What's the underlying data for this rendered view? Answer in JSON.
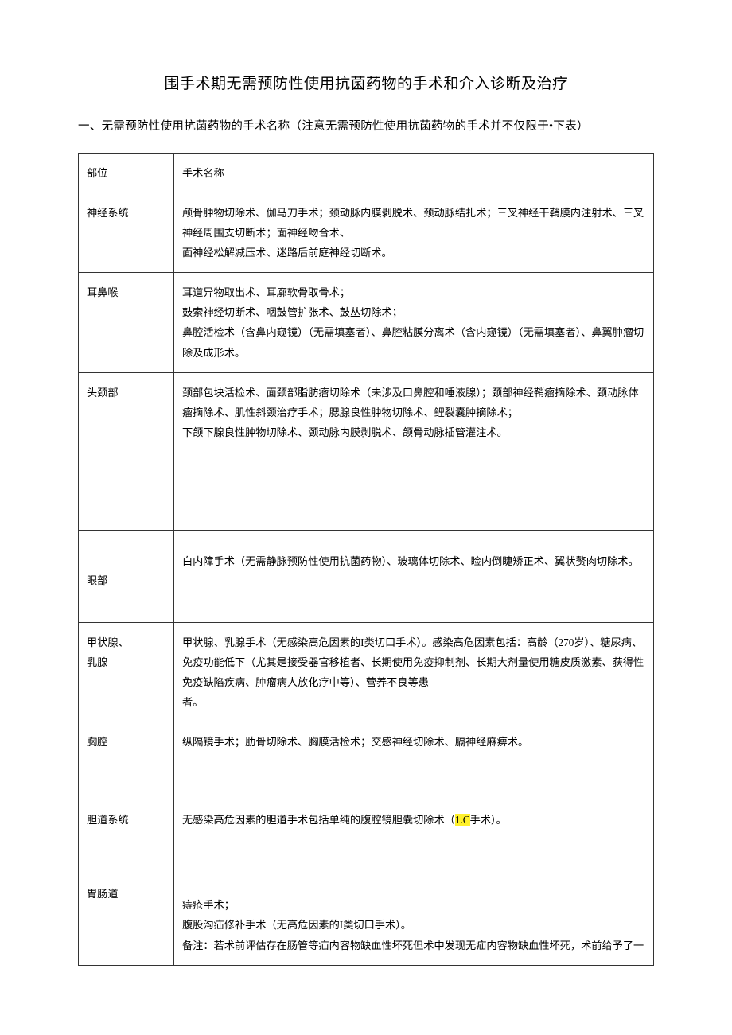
{
  "title": "围手术期无需预防性使用抗菌药物的手术和介入诊断及治疗",
  "subtitle": "一、无需预防性使用抗菌药物的手术名称（注意无需预防性使用抗菌药物的手术并不仅限于•下表）",
  "header": {
    "site": "部位",
    "name": "手术名称"
  },
  "rows": [
    {
      "site": "神经系统",
      "l1": "颅骨肿物切除术、伽马刀手术；颈动脉内膜剥脱术、颈动脉结扎术；三叉神经干鞘膜内注射术、三叉神经周围支切断术；面神经吻合术、",
      "l2": "面神经松解减压术、迷路后前庭神经切断术。"
    },
    {
      "site": "耳鼻喉",
      "l1": "耳道异物取出术、耳廓软骨取骨术；",
      "l2": "鼓索神经切断术、咽鼓管扩张术、鼓丛切除术；",
      "l3": "鼻腔活检术（含鼻内窥镜）（无需填塞者）、鼻腔粘膜分离术（含内窥镜）（无需填塞者）、鼻翼肿瘤切除及成形术。"
    },
    {
      "site": "头颈部",
      "l1": "颈部包块活检术、面颈部脂肪瘤切除术（未涉及口鼻腔和唾液腺）；颈部神经鞘瘤摘除术、颈动脉体瘤摘除术、肌性斜颈治疗手术；腮腺良性肿物切除术、鲤裂囊肿摘除术；",
      "l2": "下颌下腺良性肿物切除术、颈动脉内膜剥脱术、颌骨动脉插管灌注术。",
      "tall": true
    },
    {
      "site": "眼部",
      "l1": "白内障手术（无需静脉预防性使用抗菌药物）、玻璃体切除术、睑内倒睫矫正术、翼状赘肉切除术。",
      "eye": true,
      "pregap": true
    },
    {
      "site": "甲状腺、\n乳腺",
      "l1": "甲状腺、乳腺手术（无感染高危因素的I类切口手术）。感染高危因素包括：高龄（270岁）、糖尿病、免疫功能低下（尤其是接受器官移植者、长期使用免疫抑制剂、长期大剂量使用糖皮质激素、获得性免疫缺陷疾病、肿瘤病人放化疗中等）、营养不良等患",
      "l2": "者。"
    },
    {
      "site": "胸腔",
      "l1": "纵隔镜手术；肋骨切除术、胸膜活检术；交感神经切除术、膈神经麻痹术。",
      "chest": true
    },
    {
      "site": "胆道系统",
      "bile": true,
      "parts": {
        "p1": "无感染高危因素的胆道手术包括单纯的腹腔镜胆囊切除术（",
        "hl": "1.C",
        "p2": "手术）。"
      }
    },
    {
      "site": "胃肠道",
      "l1": "痔疮手术；",
      "l2": "腹股沟疝修补手术（无高危因素的I类切口手术）。",
      "l3": "备注：若术前评估存在肠管等疝内容物缺血性坏死但术中发现无疝内容物缺血性坏死，术前给予了一",
      "pregap": true
    }
  ]
}
